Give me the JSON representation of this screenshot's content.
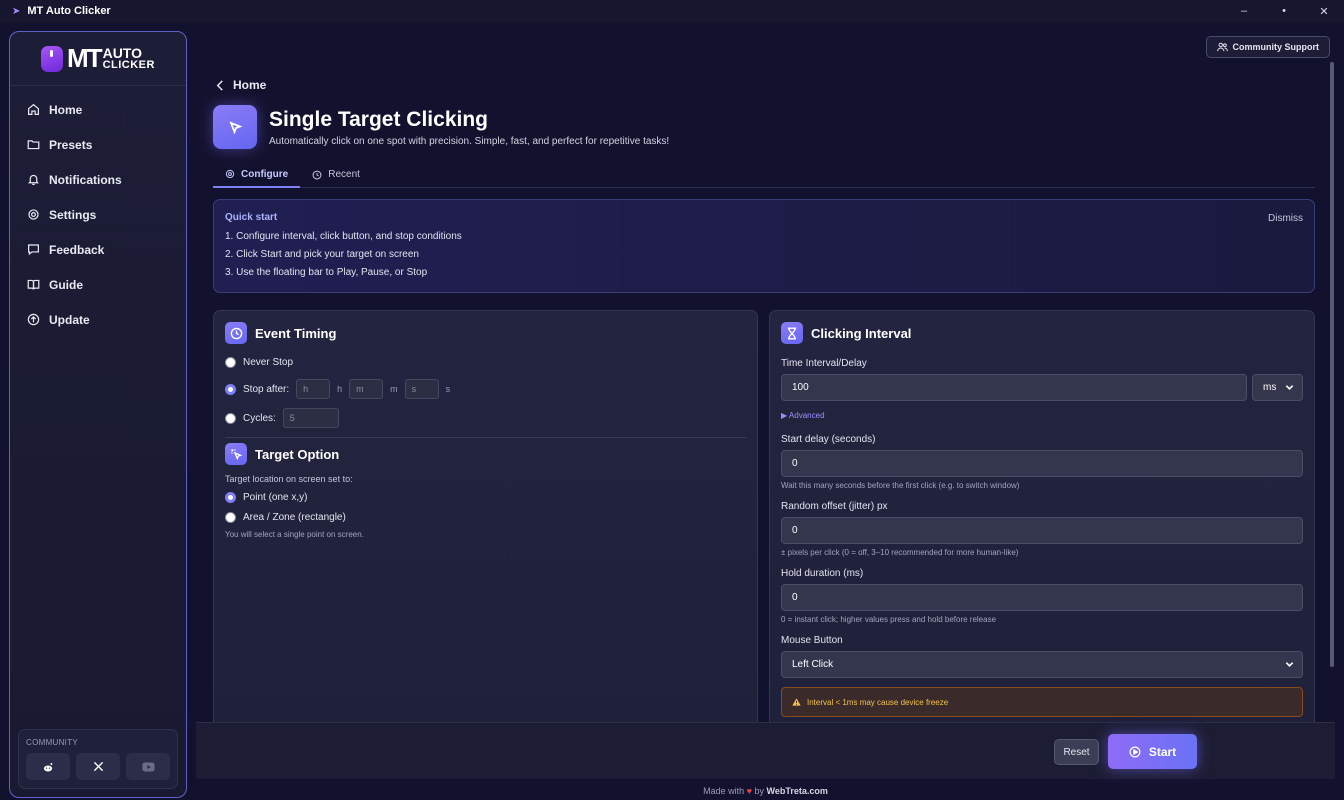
{
  "window": {
    "title": "MT Auto Clicker",
    "controls": [
      "–",
      "•",
      "✕"
    ]
  },
  "logo": {
    "m": "MT",
    "line1": "AUTO",
    "line2": "CLICKER"
  },
  "sidebar": {
    "items": [
      {
        "label": "Home",
        "icon": "home-icon"
      },
      {
        "label": "Presets",
        "icon": "folder-icon"
      },
      {
        "label": "Notifications",
        "icon": "bell-icon"
      },
      {
        "label": "Settings",
        "icon": "gear-icon"
      },
      {
        "label": "Feedback",
        "icon": "message-icon"
      },
      {
        "label": "Guide",
        "icon": "book-icon"
      },
      {
        "label": "Update",
        "icon": "upload-icon"
      }
    ],
    "community_label": "COMMUNITY",
    "social": [
      "reddit-icon",
      "x-icon",
      "youtube-icon"
    ]
  },
  "header": {
    "community_support": "Community Support",
    "breadcrumb": "Home",
    "title": "Single Target Clicking",
    "subtitle": "Automatically click on one spot with precision. Simple, fast, and perfect for repetitive tasks!"
  },
  "tabs": [
    {
      "label": "Configure",
      "active": true
    },
    {
      "label": "Recent",
      "active": false
    }
  ],
  "quickstart": {
    "title": "Quick start",
    "dismiss": "Dismiss",
    "steps": [
      "1. Configure interval, click button, and stop conditions",
      "2. Click Start and pick your target on screen",
      "3. Use the floating bar to Play, Pause, or Stop"
    ]
  },
  "event_timing": {
    "title": "Event Timing",
    "never_stop": "Never Stop",
    "stop_after": "Stop after:",
    "h_placeholder": "h",
    "h_unit": "h",
    "m_placeholder": "m",
    "m_unit": "m",
    "s_placeholder": "s",
    "s_unit": "s",
    "cycles": "Cycles:",
    "cycles_placeholder": "5",
    "selected": "stop_after"
  },
  "target_option": {
    "title": "Target Option",
    "caption": "Target location on screen set to:",
    "point": "Point (one x,y)",
    "area": "Area / Zone (rectangle)",
    "hint": "You will select a single point on screen.",
    "selected": "point"
  },
  "clicking_interval": {
    "title": "Clicking Interval",
    "time_label": "Time Interval/Delay",
    "time_value": "100",
    "unit_value": "ms",
    "advanced": "▶ Advanced",
    "start_delay_label": "Start delay (seconds)",
    "start_delay_value": "0",
    "start_delay_hint": "Wait this many seconds before the first click (e.g. to switch window)",
    "jitter_label": "Random offset (jitter) px",
    "jitter_value": "0",
    "jitter_hint": "± pixels per click (0 = off, 3–10 recommended for more human-like)",
    "hold_label": "Hold duration (ms)",
    "hold_value": "0",
    "hold_hint": "0 = instant click; higher values press and hold before release",
    "mouse_label": "Mouse Button",
    "mouse_value": "Left Click",
    "warning": "Interval < 1ms may cause device freeze"
  },
  "footer": {
    "reset": "Reset",
    "start": "Start",
    "made_with": "Made with",
    "by": "by",
    "brand": "WebTreta.com"
  },
  "colors": {
    "accent": "#7c7ff5",
    "warning": "#f5c14b",
    "heart": "#ef4444"
  }
}
